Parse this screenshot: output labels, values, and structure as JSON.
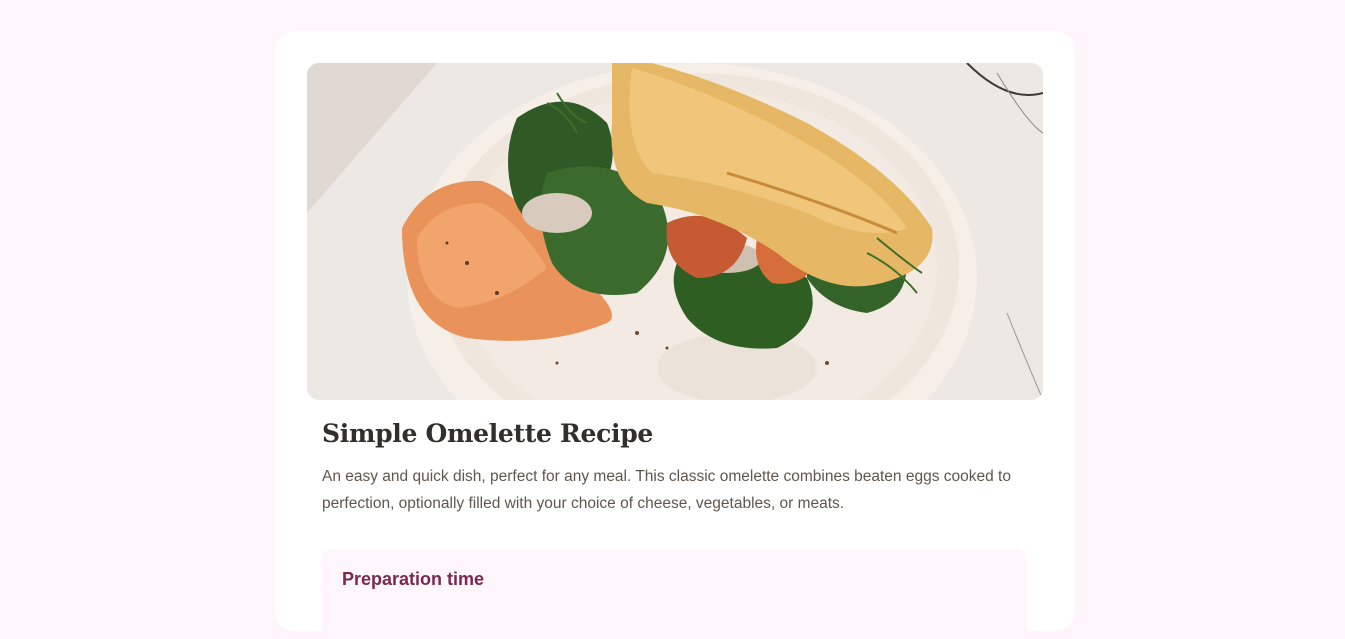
{
  "recipe": {
    "image_subject": "omelette-with-spinach-on-plate",
    "title": "Simple Omelette Recipe",
    "description": "An easy and quick dish, perfect for any meal. This classic omelette combines beaten eggs cooked to perfection, optionally filled with your choice of cheese, vegetables, or meats.",
    "preparation": {
      "heading": "Preparation time"
    }
  },
  "colors": {
    "page_bg": "#fff5fa",
    "card_bg": "#ffffff",
    "title": "#312e2c",
    "body_text": "#5f564d",
    "prep_bg": "#fff6fb",
    "prep_heading": "#7a284e"
  }
}
